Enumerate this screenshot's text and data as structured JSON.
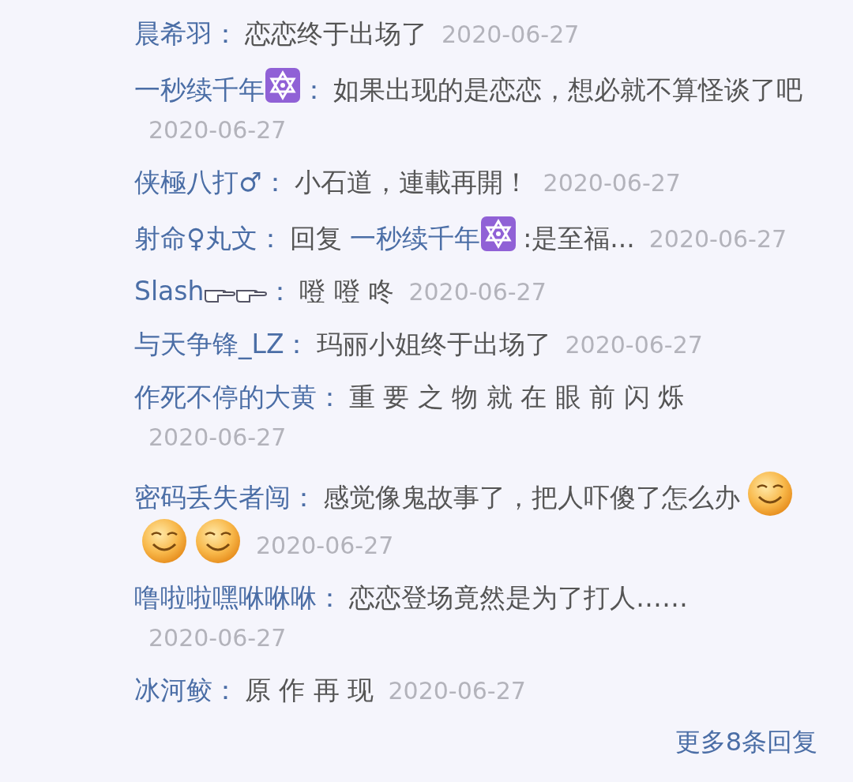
{
  "replies": [
    {
      "parts": [
        {
          "kind": "user",
          "text": "晨希羽："
        },
        {
          "kind": "text",
          "text": "恋恋终于出场了"
        },
        {
          "kind": "date",
          "text": "2020-06-27"
        }
      ]
    },
    {
      "parts": [
        {
          "kind": "user",
          "text": "一秒续千年"
        },
        {
          "kind": "star"
        },
        {
          "kind": "user",
          "text": "："
        },
        {
          "kind": "text",
          "text": "如果出现的是恋恋，想必就不算怪谈了吧"
        },
        {
          "kind": "date",
          "text": "2020-06-27"
        }
      ]
    },
    {
      "parts": [
        {
          "kind": "user",
          "text": "侠極八打♂："
        },
        {
          "kind": "text",
          "text": "小石道，連載再開！"
        },
        {
          "kind": "date",
          "text": "2020-06-27"
        }
      ]
    },
    {
      "parts": [
        {
          "kind": "user",
          "text": "射命♀丸文："
        },
        {
          "kind": "text",
          "text": "回复"
        },
        {
          "kind": "mention",
          "text": "一秒续千年"
        },
        {
          "kind": "star"
        },
        {
          "kind": "text",
          "text": ":是至福..."
        },
        {
          "kind": "date",
          "text": "2020-06-27"
        }
      ]
    },
    {
      "parts": [
        {
          "kind": "user",
          "text": "Slash"
        },
        {
          "kind": "hand"
        },
        {
          "kind": "hand"
        },
        {
          "kind": "user",
          "text": "："
        },
        {
          "kind": "text",
          "text": "噔 噔 咚"
        },
        {
          "kind": "date",
          "text": "2020-06-27"
        }
      ]
    },
    {
      "parts": [
        {
          "kind": "user",
          "text": "与天争锋_LZ："
        },
        {
          "kind": "text",
          "text": "玛丽小姐终于出场了"
        },
        {
          "kind": "date",
          "text": "2020-06-27"
        }
      ]
    },
    {
      "parts": [
        {
          "kind": "user",
          "text": "作死不停的大黄："
        },
        {
          "kind": "text",
          "text": "重 要 之 物 就 在 眼 前 闪 烁"
        },
        {
          "kind": "date",
          "text": "2020-06-27"
        }
      ]
    },
    {
      "parts": [
        {
          "kind": "user",
          "text": "密码丢失者闯："
        },
        {
          "kind": "text",
          "text": "感觉像鬼故事了，把人吓傻了怎么办"
        },
        {
          "kind": "smiley"
        },
        {
          "kind": "smiley"
        },
        {
          "kind": "smiley"
        },
        {
          "kind": "date",
          "text": "2020-06-27"
        }
      ]
    },
    {
      "parts": [
        {
          "kind": "user",
          "text": "噜啦啦嘿咻咻咻："
        },
        {
          "kind": "text",
          "text": "恋恋登场竟然是为了打人……"
        },
        {
          "kind": "date",
          "text": "2020-06-27"
        }
      ]
    },
    {
      "parts": [
        {
          "kind": "user",
          "text": "冰河鲛："
        },
        {
          "kind": "text",
          "text": "原 作 再 现"
        },
        {
          "kind": "date",
          "text": "2020-06-27"
        }
      ]
    }
  ],
  "more_link": "更多8条回复"
}
